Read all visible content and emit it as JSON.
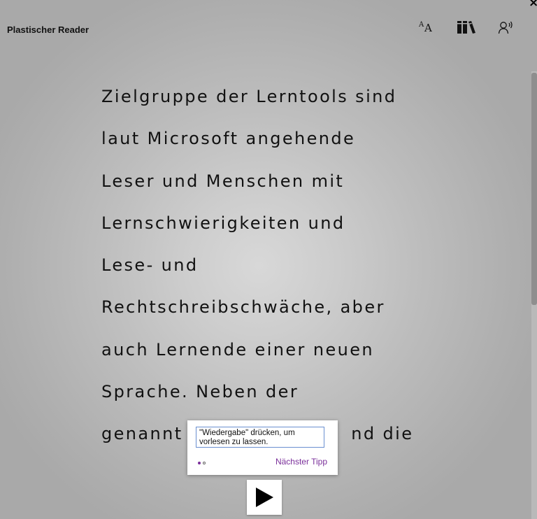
{
  "app": {
    "title": "Plastischer Reader",
    "close_label": "×"
  },
  "toolbar": {
    "icons": [
      "text-preferences-icon",
      "grammar-options-icon",
      "voice-options-icon"
    ]
  },
  "reading": {
    "lines": [
      "Zielgruppe der Lerntools sind",
      "laut Microsoft angehende",
      "Leser und Menschen mit",
      "Lernschwierigkeiten und",
      "Lese- und",
      "Rechtschreibschwäche, aber",
      "auch Lernende einer neuen",
      "Sprache. Neben der",
      "genannt                        nd die",
      ".      .      .                        .   ."
    ]
  },
  "tip": {
    "text": "\"Wiedergabe\" drücken, um vorlesen zu lassen.",
    "next_label": "Nächster Tipp",
    "current_step": 1,
    "total_steps": 2
  },
  "colors": {
    "accent": "#7a2f9a",
    "tip_border": "#6a8fd0"
  }
}
